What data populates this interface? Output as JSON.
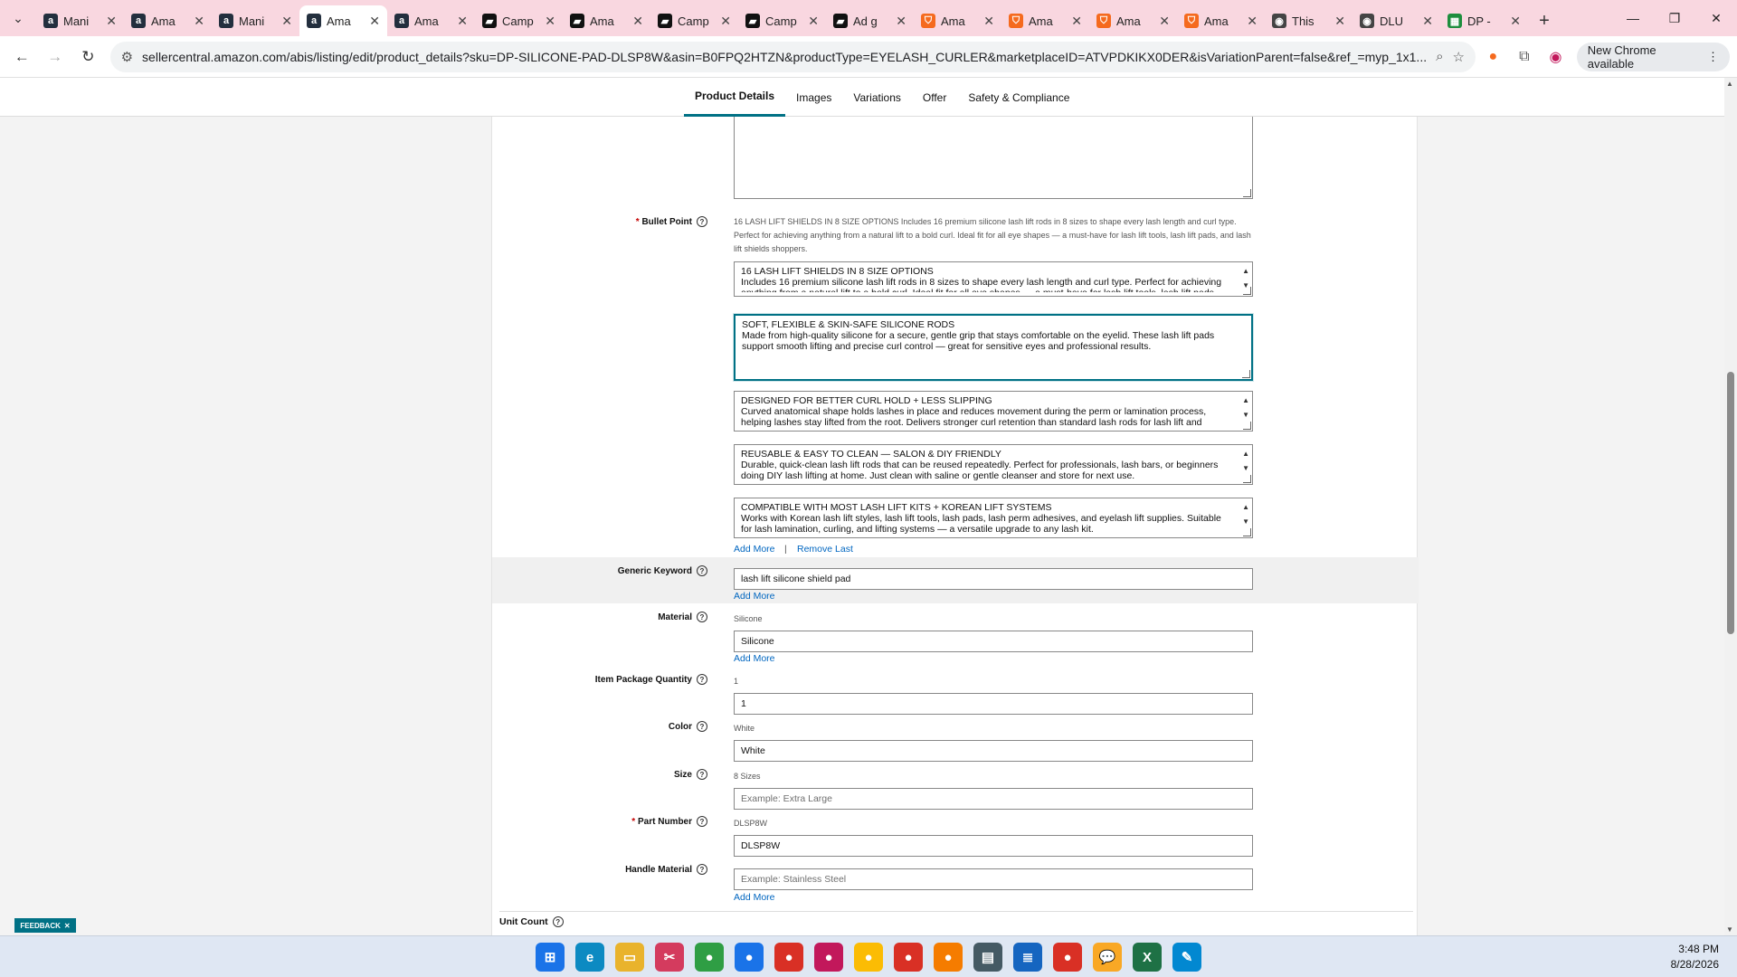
{
  "browser": {
    "tabs": [
      {
        "title": "Mani",
        "icon": "amazon-icon",
        "color": "#232f3e"
      },
      {
        "title": "Ama",
        "icon": "amazon-icon",
        "color": "#232f3e"
      },
      {
        "title": "Mani",
        "icon": "amazon-icon",
        "color": "#232f3e"
      },
      {
        "title": "Ama",
        "icon": "amazon-icon",
        "color": "#232f3e",
        "active": true
      },
      {
        "title": "Ama",
        "icon": "amazon-icon",
        "color": "#232f3e"
      },
      {
        "title": "Camp",
        "icon": "campaign-icon",
        "color": "#111111"
      },
      {
        "title": "Ama",
        "icon": "campaign-icon",
        "color": "#111111"
      },
      {
        "title": "Camp",
        "icon": "campaign-icon",
        "color": "#111111"
      },
      {
        "title": "Camp",
        "icon": "campaign-icon",
        "color": "#111111"
      },
      {
        "title": "Ad g",
        "icon": "ad-icon",
        "color": "#111111"
      },
      {
        "title": "Ama",
        "icon": "shop-icon",
        "color": "#f56a1e"
      },
      {
        "title": "Ama",
        "icon": "shop-icon",
        "color": "#f56a1e"
      },
      {
        "title": "Ama",
        "icon": "shop-icon",
        "color": "#f56a1e"
      },
      {
        "title": "Ama",
        "icon": "shop-icon",
        "color": "#f56a1e"
      },
      {
        "title": "This",
        "icon": "globe-icon",
        "color": "#444444"
      },
      {
        "title": "DLU",
        "icon": "globe-icon",
        "color": "#444444"
      },
      {
        "title": "DP -",
        "icon": "sheets-icon",
        "color": "#1e8e3e"
      }
    ],
    "url": "sellercentral.amazon.com/abis/listing/edit/product_details?sku=DP-SILICONE-PAD-DLSP8W&asin=B0FPQ2HTZN&productType=EYELASH_CURLER&marketplaceID=ATVPDKIKX0DER&isVariationParent=false&ref_=myp_1x1...",
    "chrome_available": "New Chrome available"
  },
  "subnav": {
    "tabs": [
      "Product Details",
      "Images",
      "Variations",
      "Offer",
      "Safety & Compliance"
    ]
  },
  "form": {
    "bullet_point": {
      "label": "Bullet Point",
      "hint": "16 LASH LIFT SHIELDS IN 8 SIZE OPTIONS Includes 16 premium silicone lash lift rods in 8 sizes to shape every lash length and curl type. Perfect for achieving anything from a natural lift to a bold curl. Ideal fit for all eye shapes — a must-have for lash lift tools, lash lift pads, and lash lift shields shoppers.",
      "items": [
        {
          "title": "16 LASH LIFT SHIELDS IN 8 SIZE OPTIONS",
          "body": "Includes 16 premium silicone lash lift rods in 8 sizes to shape every lash length and curl type. Perfect for achieving anything from a natural lift to a bold curl. Ideal fit for all eye shapes — a must-have for lash lift tools, lash lift pads, and lash lift shields shoppers."
        },
        {
          "title": "SOFT, FLEXIBLE & SKIN-SAFE SILICONE RODS",
          "body": "Made from high-quality silicone for a secure, gentle grip that stays comfortable on the eyelid. These lash lift pads support smooth lifting and precise curl control — great for sensitive eyes and professional results."
        },
        {
          "title": "DESIGNED FOR BETTER CURL HOLD + LESS SLIPPING",
          "body": "Curved anatomical shape holds lashes in place and reduces movement during the perm or lamination process, helping lashes stay lifted from the root. Delivers stronger curl retention than standard lash rods for lash lift and"
        },
        {
          "title": "REUSABLE & EASY TO CLEAN — SALON & DIY FRIENDLY",
          "body": "Durable, quick-clean lash lift rods that can be reused repeatedly. Perfect for professionals, lash bars, or beginners doing DIY lash lifting at home. Just clean with saline or gentle cleanser and store for next use."
        },
        {
          "title": "COMPATIBLE WITH MOST LASH LIFT KITS + KOREAN LIFT SYSTEMS",
          "body": "Works with Korean lash lift styles, lash lift tools, lash pads, lash perm adhesives, and eyelash lift supplies. Suitable for lash lamination, curling, and lifting systems — a versatile upgrade to any lash kit."
        }
      ],
      "add_more": "Add More",
      "separator": "|",
      "remove_last": "Remove Last"
    },
    "generic_keyword": {
      "label": "Generic Keyword",
      "value": "lash lift silicone shield pad",
      "add_more": "Add More"
    },
    "material": {
      "label": "Material",
      "hint": "Silicone",
      "value": "Silicone",
      "add_more": "Add More"
    },
    "item_package_quantity": {
      "label": "Item Package Quantity",
      "hint": "1",
      "value": "1"
    },
    "color": {
      "label": "Color",
      "hint": "White",
      "value": "White"
    },
    "size": {
      "label": "Size",
      "hint": "8 Sizes",
      "placeholder": "Example: Extra Large"
    },
    "part_number": {
      "label": "Part Number",
      "hint": "DLSP8W",
      "value": "DLSP8W"
    },
    "handle_material": {
      "label": "Handle Material",
      "placeholder": "Example: Stainless Steel",
      "add_more": "Add More"
    },
    "unit_count": {
      "label": "Unit Count"
    }
  },
  "feedback": "FEEDBACK",
  "clock": {
    "time": "3:48 PM",
    "date": "8/28/2026"
  },
  "taskbar_icons": [
    {
      "name": "windows-start-icon",
      "color": "#1a73e8",
      "glyph": "⊞"
    },
    {
      "name": "edge-icon",
      "color": "#0c8ac2",
      "glyph": "e"
    },
    {
      "name": "file-explorer-icon",
      "color": "#e9b32c",
      "glyph": "▭"
    },
    {
      "name": "snipping-tool-icon",
      "color": "#d43b5e",
      "glyph": "✂"
    },
    {
      "name": "chrome-icon",
      "color": "#2f9e44",
      "glyph": "●"
    },
    {
      "name": "chrome-icon",
      "color": "#1a73e8",
      "glyph": "●"
    },
    {
      "name": "chrome-icon",
      "color": "#d93025",
      "glyph": "●"
    },
    {
      "name": "chrome-icon",
      "color": "#c2185b",
      "glyph": "●"
    },
    {
      "name": "chrome-icon",
      "color": "#fbbc04",
      "glyph": "●"
    },
    {
      "name": "chrome-icon",
      "color": "#d93025",
      "glyph": "●"
    },
    {
      "name": "chrome-icon",
      "color": "#f57c00",
      "glyph": "●"
    },
    {
      "name": "app-icon",
      "color": "#455a64",
      "glyph": "▤"
    },
    {
      "name": "notepad-icon",
      "color": "#1565c0",
      "glyph": "≣"
    },
    {
      "name": "chrome-icon",
      "color": "#d93025",
      "glyph": "●"
    },
    {
      "name": "chat-icon",
      "color": "#f9a825",
      "glyph": "💬"
    },
    {
      "name": "excel-icon",
      "color": "#1e7145",
      "glyph": "X"
    },
    {
      "name": "paint-icon",
      "color": "#0288d1",
      "glyph": "✎"
    }
  ]
}
